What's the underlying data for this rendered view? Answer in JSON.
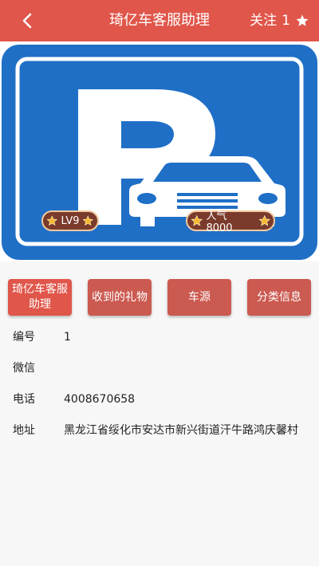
{
  "header": {
    "title": "琦亿车客服助理",
    "follow_label": "关注",
    "follow_count": "1"
  },
  "banner": {
    "level_badge": "LV9",
    "popularity_badge": "人气 8000",
    "colors": {
      "sign_blue": "#1f6fc6",
      "sign_white": "#ffffff"
    }
  },
  "tabs": [
    {
      "label": "琦亿车客服助理",
      "active": true
    },
    {
      "label": "收到的礼物",
      "active": false
    },
    {
      "label": "车源",
      "active": false
    },
    {
      "label": "分类信息",
      "active": false
    }
  ],
  "info": [
    {
      "label": "编号",
      "value": "1"
    },
    {
      "label": "微信",
      "value": ""
    },
    {
      "label": "电话",
      "value": "4008670658"
    },
    {
      "label": "地址",
      "value": "黑龙江省绥化市安达市新兴街道汗牛路鸿庆馨村"
    }
  ],
  "colors": {
    "accent": "#e0564a",
    "tab_bg": "#cb5a50",
    "page_bg": "#f7f7f7"
  }
}
